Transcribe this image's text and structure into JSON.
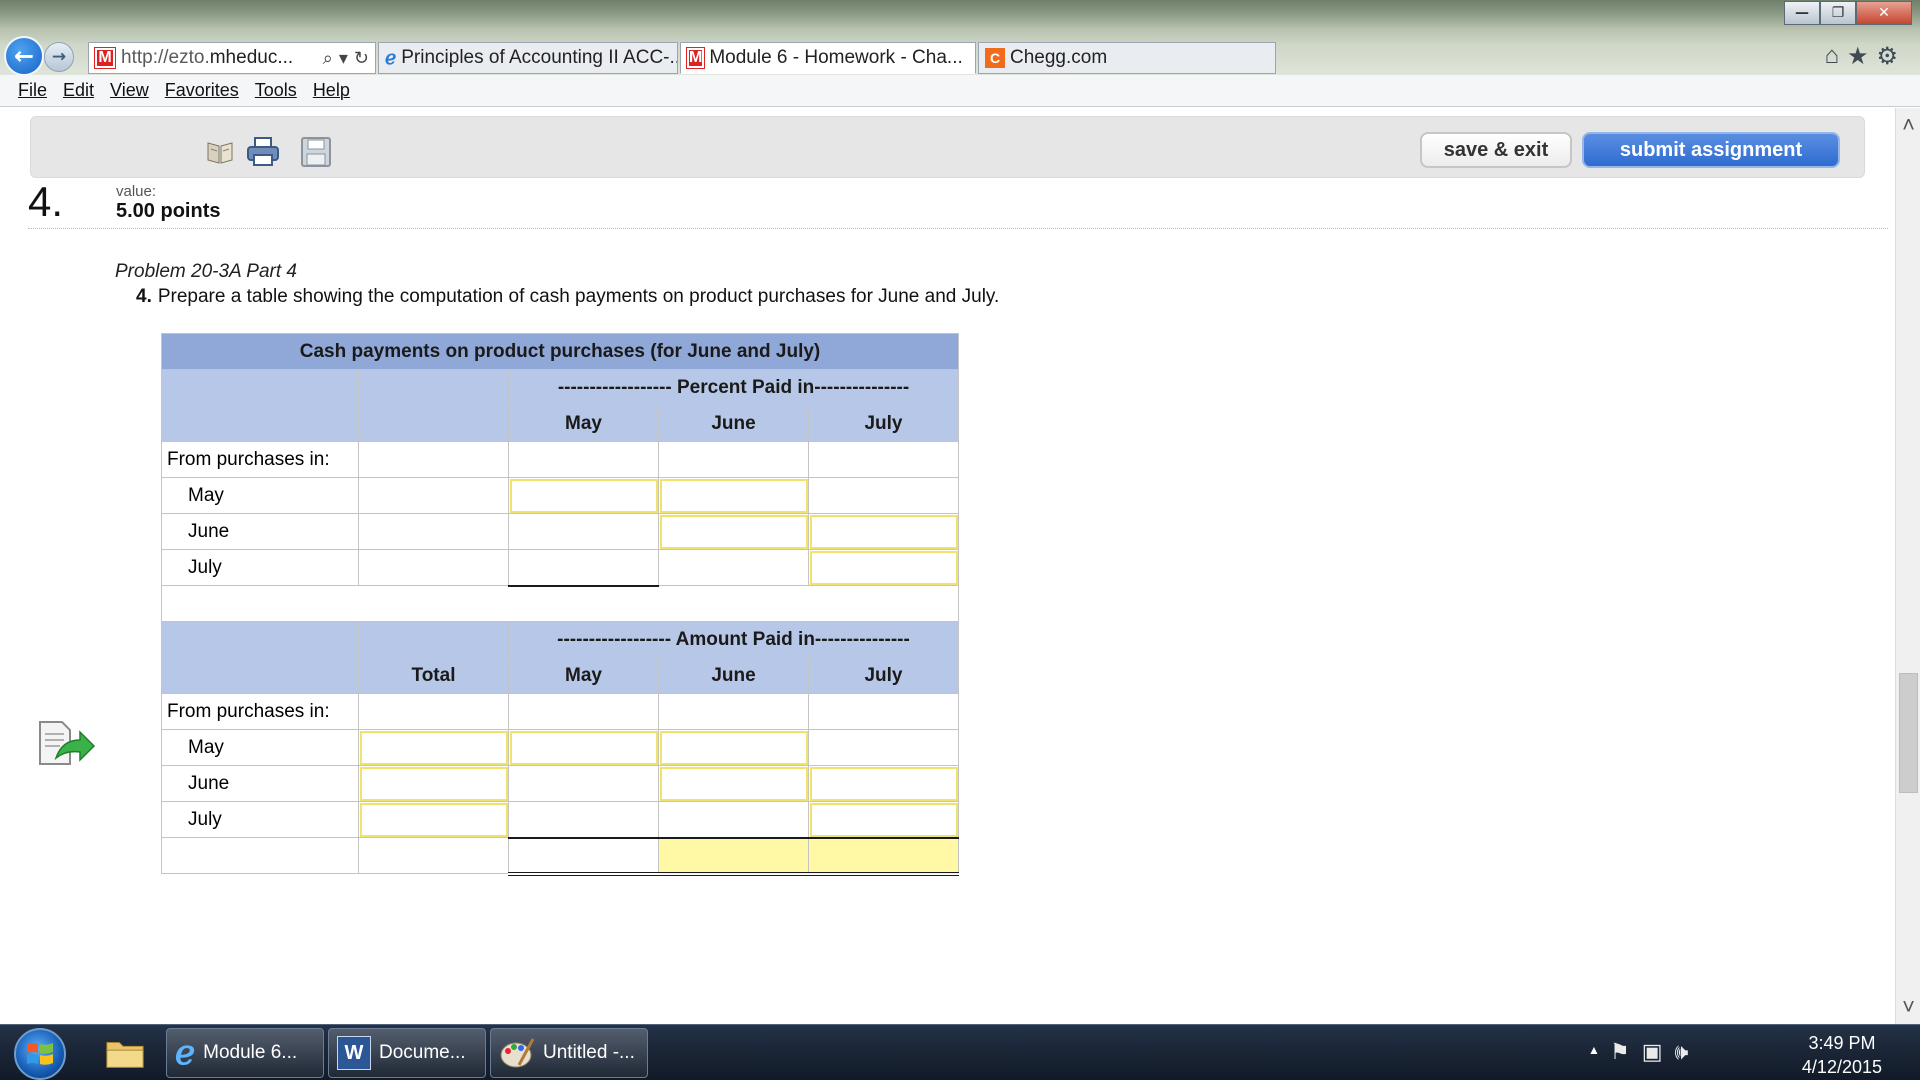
{
  "browser": {
    "address": {
      "prefix": "http://ezto.",
      "domain": "mheduc...",
      "search_icon": "search-icon",
      "refresh_icon": "refresh-icon"
    },
    "tabs": [
      {
        "label": "Principles of Accounting II ACC-...",
        "icon": "ie-icon"
      },
      {
        "label": "Module 6 - Homework - Cha...",
        "icon": "mcgraw-hill-icon",
        "close": "×"
      },
      {
        "label": "Chegg.com",
        "icon": "chegg-icon"
      }
    ],
    "window_controls": {
      "minimize": "—",
      "maximize": "❐",
      "close": "✕"
    },
    "right_icons": [
      "home-icon",
      "favorites-star-icon",
      "settings-gear-icon"
    ]
  },
  "menu": [
    "File",
    "Edit",
    "View",
    "Favorites",
    "Tools",
    "Help"
  ],
  "toolbar": {
    "icons": [
      "book-icon",
      "print-icon",
      "save-disk-icon"
    ],
    "save_exit": "save & exit",
    "submit": "submit assignment"
  },
  "question": {
    "number": "4.",
    "value_label": "value:",
    "points": "5.00 points",
    "problem_title": "Problem 20-3A Part 4",
    "instruction_num": "4.",
    "instruction": "Prepare a table showing the computation of cash payments on product purchases for June and July."
  },
  "table": {
    "title": "Cash payments on product purchases (for June and July)",
    "percent_header": "------------------ Percent Paid in---------------",
    "amount_header": "------------------ Amount Paid in---------------",
    "total_col": "Total",
    "months": [
      "May",
      "June",
      "July"
    ],
    "from_label": "From purchases in:",
    "rows": [
      "May",
      "June",
      "July"
    ]
  },
  "taskbar": {
    "buttons": [
      {
        "label": "Module 6...",
        "icon": "ie-icon"
      },
      {
        "label": "Docume...",
        "icon": "word-icon"
      },
      {
        "label": "Untitled -...",
        "icon": "paint-icon"
      }
    ],
    "pinned": [
      "file-explorer-icon"
    ],
    "clock": {
      "time": "3:49 PM",
      "date": "4/12/2015"
    },
    "tray_icons": [
      "action-center-flag-icon",
      "network-icon",
      "volume-icon"
    ]
  }
}
